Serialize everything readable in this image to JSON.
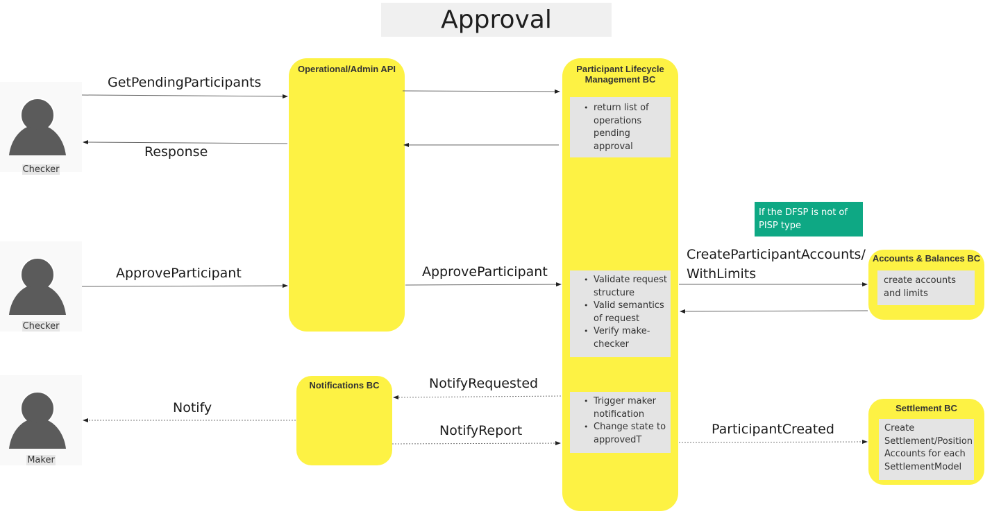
{
  "title": "Approval",
  "actors": [
    {
      "id": "checker-1",
      "label": "Checker"
    },
    {
      "id": "checker-2",
      "label": "Checker"
    },
    {
      "id": "maker",
      "label": "Maker"
    }
  ],
  "components": {
    "admin_api": {
      "title": "Operational/Admin API"
    },
    "plm": {
      "title_line1": "Participant Lifecycle",
      "title_line2": "Management BC",
      "notes": [
        {
          "items": [
            "return list of operations pending approval"
          ]
        },
        {
          "items": [
            "Validate request structure",
            "Valid semantics of request",
            "Verify make-checker"
          ]
        },
        {
          "items": [
            "Trigger maker notification",
            "Change state to approvedT"
          ]
        }
      ]
    },
    "notifications": {
      "title": "Notifications BC"
    },
    "accounts": {
      "title": "Accounts & Balances BC",
      "note": "create accounts and limits"
    },
    "settlement": {
      "title": "Settlement BC",
      "note": "Create Settlement/Position Accounts for each SettlementModel"
    }
  },
  "condition_note": "If the DFSP is not of PISP type",
  "messages": [
    {
      "label": "GetPendingParticipants",
      "from": "Checker",
      "to": "Operational/Admin API",
      "style": "solid"
    },
    {
      "label": "",
      "from": "Operational/Admin API",
      "to": "Participant Lifecycle Management BC",
      "style": "solid"
    },
    {
      "label": "",
      "from": "Participant Lifecycle Management BC",
      "to": "Operational/Admin API",
      "style": "solid"
    },
    {
      "label": "Response",
      "from": "Operational/Admin API",
      "to": "Checker",
      "style": "solid"
    },
    {
      "label": "ApproveParticipant",
      "from": "Checker",
      "to": "Operational/Admin API",
      "style": "solid"
    },
    {
      "label": "ApproveParticipant",
      "from": "Operational/Admin API",
      "to": "Participant Lifecycle Management BC",
      "style": "solid"
    },
    {
      "label": "CreateParticipantAccounts/ WithLimits",
      "label_line1": "CreateParticipantAccounts/",
      "label_line2": "WithLimits",
      "from": "Participant Lifecycle Management BC",
      "to": "Accounts & Balances BC",
      "style": "solid"
    },
    {
      "label": "",
      "from": "Accounts & Balances BC",
      "to": "Participant Lifecycle Management BC",
      "style": "solid"
    },
    {
      "label": "NotifyRequested",
      "from": "Participant Lifecycle Management BC",
      "to": "Notifications BC",
      "style": "dotted"
    },
    {
      "label": "Notify",
      "from": "Notifications BC",
      "to": "Maker",
      "style": "dotted"
    },
    {
      "label": "NotifyReport",
      "from": "Notifications BC",
      "to": "Participant Lifecycle Management BC",
      "style": "dotted"
    },
    {
      "label": "ParticipantCreated",
      "from": "Participant Lifecycle Management BC",
      "to": "Settlement BC",
      "style": "dotted"
    }
  ],
  "colors": {
    "lane_fill": "#fdf244",
    "note_fill": "#e4e4e4",
    "condition_fill": "#0ea884",
    "actor_fill": "#5b5b5b"
  }
}
